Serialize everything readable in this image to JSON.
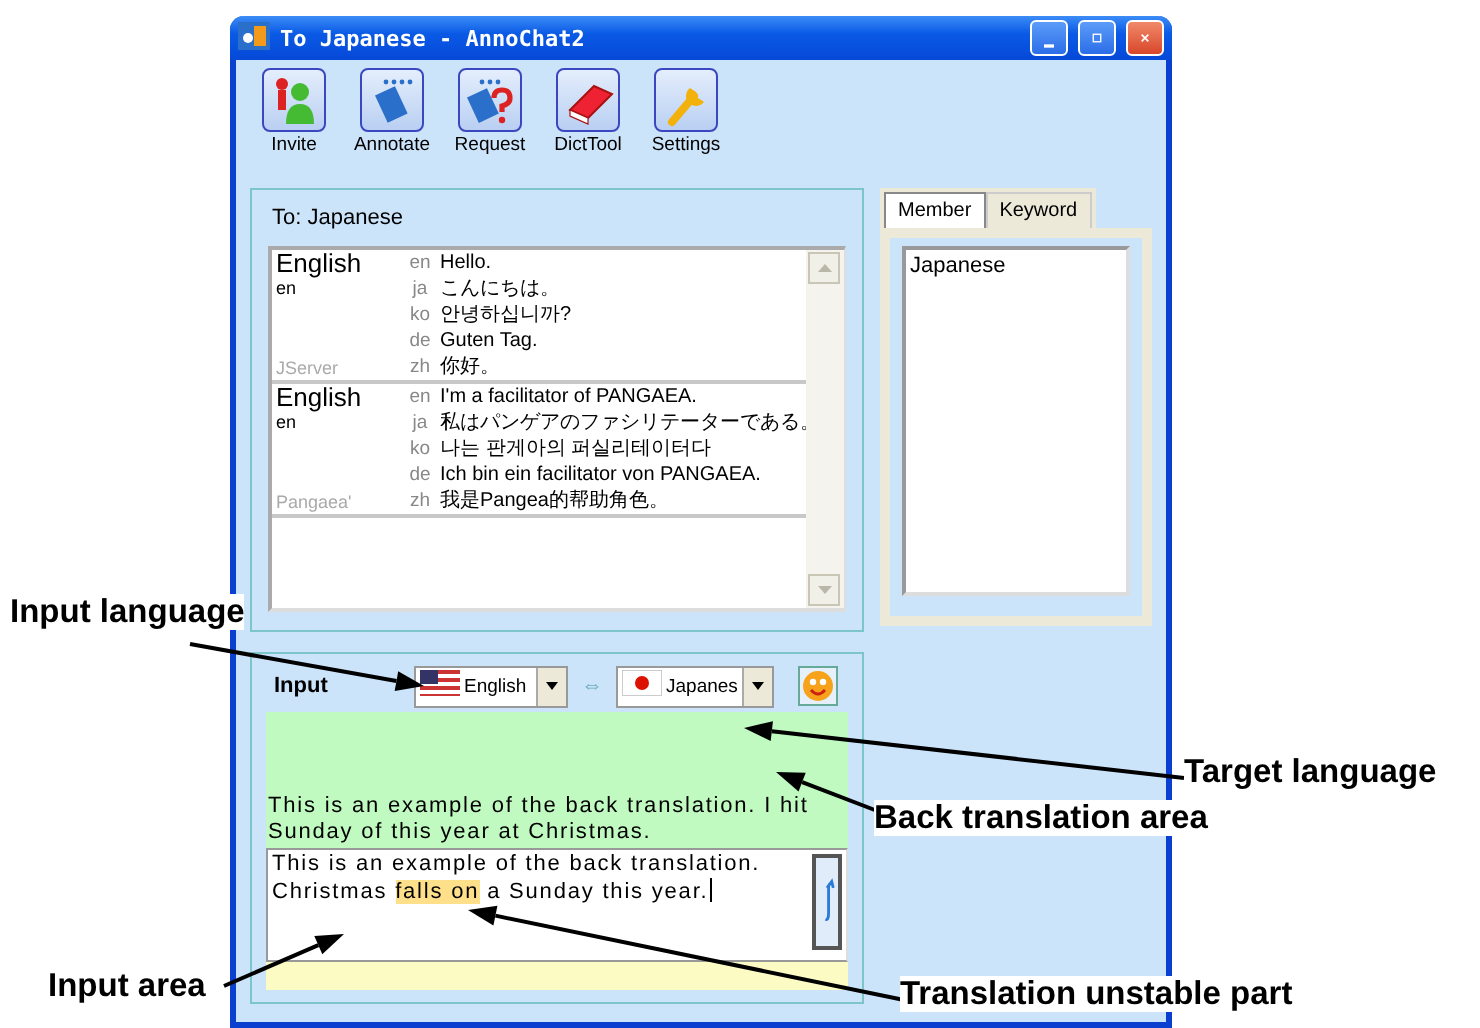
{
  "window": {
    "title": "To Japanese - AnnoChat2"
  },
  "toolbar": [
    {
      "label": "Invite"
    },
    {
      "label": "Annotate"
    },
    {
      "label": "Request"
    },
    {
      "label": "DictTool"
    },
    {
      "label": "Settings"
    }
  ],
  "chat": {
    "title": "To: Japanese",
    "messages": [
      {
        "language": "English",
        "language_code": "en",
        "sender": "JServer",
        "translations": [
          {
            "code": "en",
            "text": "Hello."
          },
          {
            "code": "ja",
            "text": "こんにちは。"
          },
          {
            "code": "ko",
            "text": "안녕하십니까?"
          },
          {
            "code": "de",
            "text": "Guten Tag."
          },
          {
            "code": "zh",
            "text": "你好。"
          }
        ]
      },
      {
        "language": "English",
        "language_code": "en",
        "sender": "Pangaea'",
        "translations": [
          {
            "code": "en",
            "text": "I'm a facilitator of PANGAEA."
          },
          {
            "code": "ja",
            "text": "私はパンゲアのファシリテーターである。"
          },
          {
            "code": "ko",
            "text": "나는 판게아의 퍼실리테이터다"
          },
          {
            "code": "de",
            "text": "Ich bin ein facilitator von PANGAEA."
          },
          {
            "code": "zh",
            "text": "我是Pangea的帮助角色。"
          }
        ]
      }
    ]
  },
  "side_panel": {
    "tabs": [
      {
        "label": "Member",
        "selected": true
      },
      {
        "label": "Keyword",
        "selected": false
      }
    ],
    "members": [
      "Japanese"
    ]
  },
  "input": {
    "label": "Input",
    "source_language": "English",
    "swap_symbol": "⇔",
    "target_language": "Japanes",
    "back_translation": "This is an example of the back translation. I hit Sunday of this year at Christmas.",
    "segments": [
      {
        "text": "This is an example of the back translation. Christmas ",
        "unstable": false
      },
      {
        "text": "falls on",
        "unstable": true
      },
      {
        "text": " a Sunday this year.",
        "unstable": false
      }
    ]
  },
  "callouts": [
    {
      "text": "Input language"
    },
    {
      "text": "Target language"
    },
    {
      "text": "Back translation area"
    },
    {
      "text": "Input area"
    },
    {
      "text": "Translation unstable part"
    }
  ]
}
